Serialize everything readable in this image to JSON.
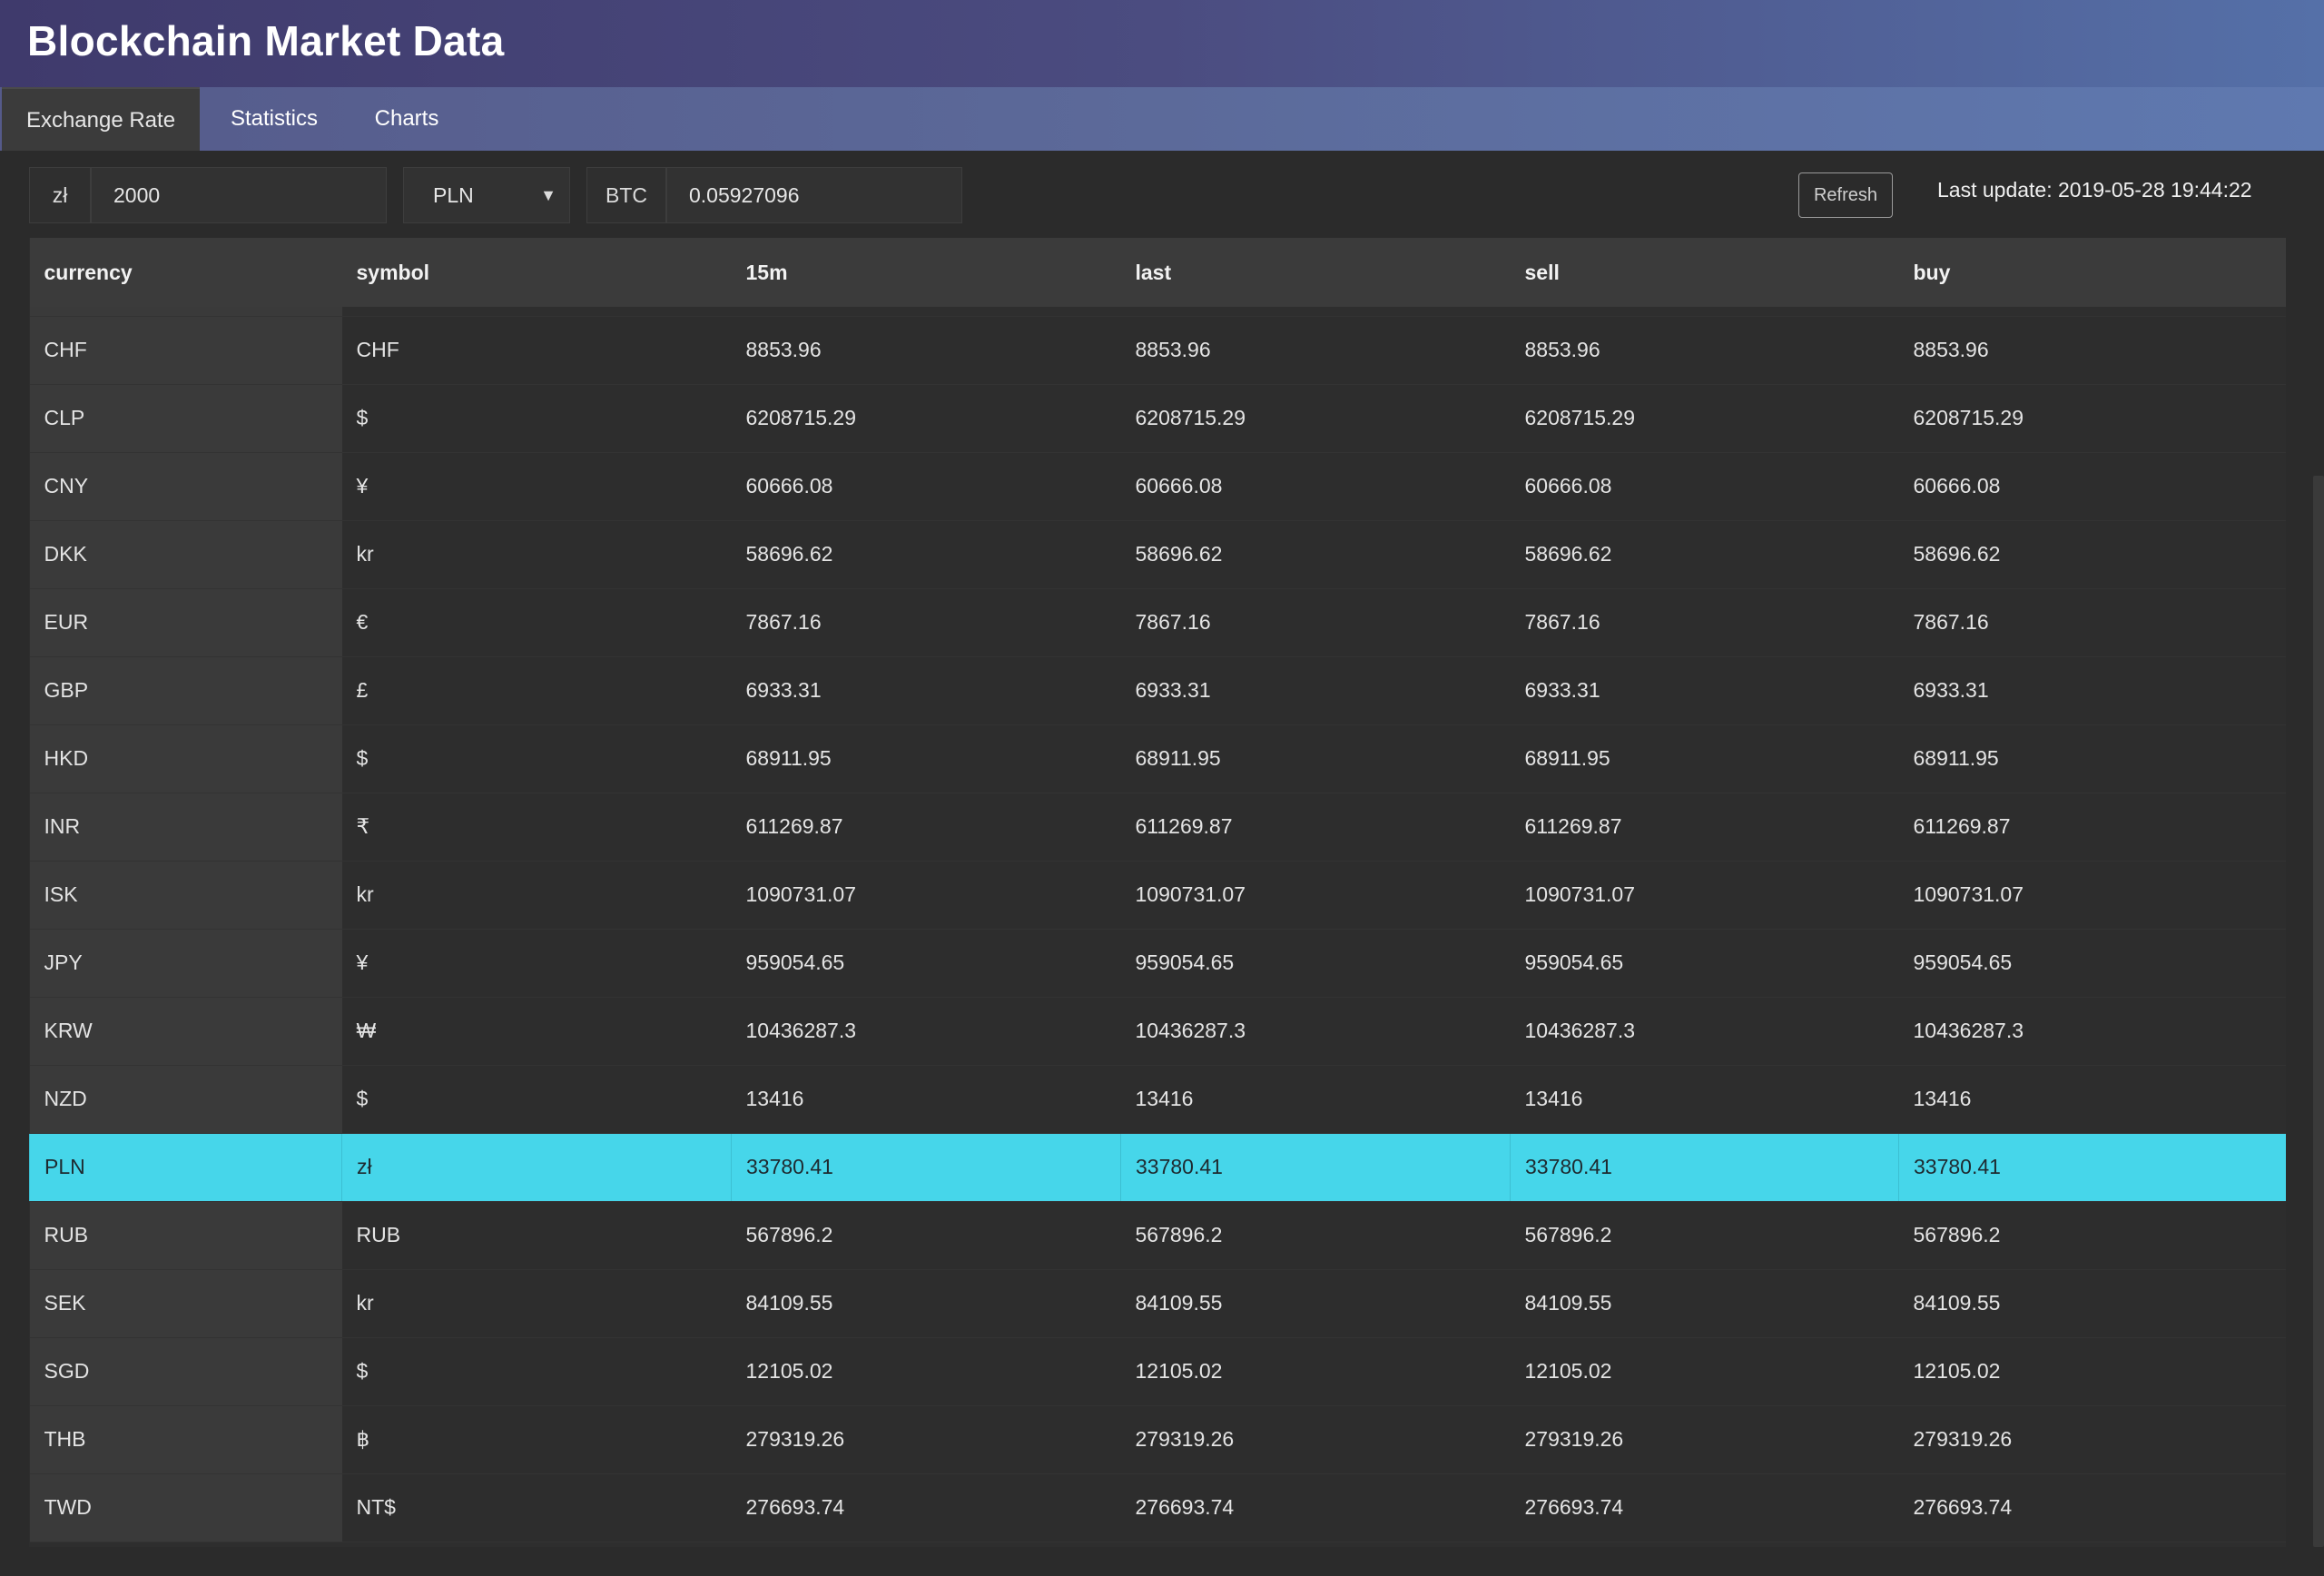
{
  "app": {
    "title": "Blockchain Market Data"
  },
  "tabs": [
    {
      "label": "Exchange Rate",
      "active": true
    },
    {
      "label": "Statistics",
      "active": false
    },
    {
      "label": "Charts",
      "active": false
    }
  ],
  "converter": {
    "currency_symbol": "zł",
    "amount_value": "2000",
    "currency_selected": "PLN",
    "crypto_label": "BTC",
    "crypto_value": "0.05927096"
  },
  "toolbar": {
    "refresh_label": "Refresh",
    "last_update": "Last update: 2019-05-28 19:44:22"
  },
  "table": {
    "columns": [
      "currency",
      "symbol",
      "15m",
      "last",
      "sell",
      "buy"
    ],
    "selected_row": "PLN",
    "rows": [
      {
        "currency": "CHF",
        "symbol": "CHF",
        "m15": "8853.96",
        "last": "8853.96",
        "sell": "8853.96",
        "buy": "8853.96"
      },
      {
        "currency": "CLP",
        "symbol": "$",
        "m15": "6208715.29",
        "last": "6208715.29",
        "sell": "6208715.29",
        "buy": "6208715.29"
      },
      {
        "currency": "CNY",
        "symbol": "¥",
        "m15": "60666.08",
        "last": "60666.08",
        "sell": "60666.08",
        "buy": "60666.08"
      },
      {
        "currency": "DKK",
        "symbol": "kr",
        "m15": "58696.62",
        "last": "58696.62",
        "sell": "58696.62",
        "buy": "58696.62"
      },
      {
        "currency": "EUR",
        "symbol": "€",
        "m15": "7867.16",
        "last": "7867.16",
        "sell": "7867.16",
        "buy": "7867.16"
      },
      {
        "currency": "GBP",
        "symbol": "£",
        "m15": "6933.31",
        "last": "6933.31",
        "sell": "6933.31",
        "buy": "6933.31"
      },
      {
        "currency": "HKD",
        "symbol": "$",
        "m15": "68911.95",
        "last": "68911.95",
        "sell": "68911.95",
        "buy": "68911.95"
      },
      {
        "currency": "INR",
        "symbol": "₹",
        "m15": "611269.87",
        "last": "611269.87",
        "sell": "611269.87",
        "buy": "611269.87"
      },
      {
        "currency": "ISK",
        "symbol": "kr",
        "m15": "1090731.07",
        "last": "1090731.07",
        "sell": "1090731.07",
        "buy": "1090731.07"
      },
      {
        "currency": "JPY",
        "symbol": "¥",
        "m15": "959054.65",
        "last": "959054.65",
        "sell": "959054.65",
        "buy": "959054.65"
      },
      {
        "currency": "KRW",
        "symbol": "₩",
        "m15": "10436287.3",
        "last": "10436287.3",
        "sell": "10436287.3",
        "buy": "10436287.3"
      },
      {
        "currency": "NZD",
        "symbol": "$",
        "m15": "13416",
        "last": "13416",
        "sell": "13416",
        "buy": "13416"
      },
      {
        "currency": "PLN",
        "symbol": "zł",
        "m15": "33780.41",
        "last": "33780.41",
        "sell": "33780.41",
        "buy": "33780.41"
      },
      {
        "currency": "RUB",
        "symbol": "RUB",
        "m15": "567896.2",
        "last": "567896.2",
        "sell": "567896.2",
        "buy": "567896.2"
      },
      {
        "currency": "SEK",
        "symbol": "kr",
        "m15": "84109.55",
        "last": "84109.55",
        "sell": "84109.55",
        "buy": "84109.55"
      },
      {
        "currency": "SGD",
        "symbol": "$",
        "m15": "12105.02",
        "last": "12105.02",
        "sell": "12105.02",
        "buy": "12105.02"
      },
      {
        "currency": "THB",
        "symbol": "฿",
        "m15": "279319.26",
        "last": "279319.26",
        "sell": "279319.26",
        "buy": "279319.26"
      },
      {
        "currency": "TWD",
        "symbol": "NT$",
        "m15": "276693.74",
        "last": "276693.74",
        "sell": "276693.74",
        "buy": "276693.74"
      }
    ]
  }
}
